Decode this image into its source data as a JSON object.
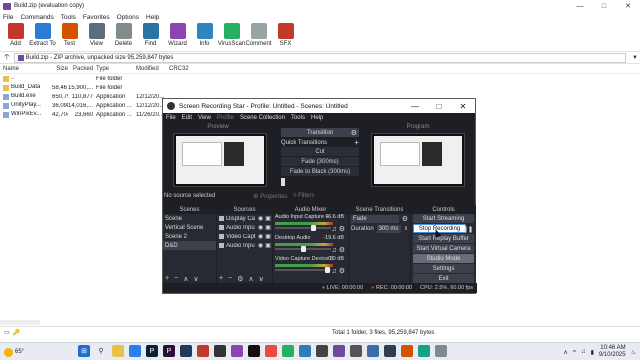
{
  "winrar": {
    "title": "Build.zip (evaluation copy)",
    "menu": [
      "File",
      "Commands",
      "Tools",
      "Favorites",
      "Options",
      "Help"
    ],
    "toolbar": [
      {
        "label": "Add",
        "icon": "add-archive-icon",
        "color": "#c0392b"
      },
      {
        "label": "Extract To",
        "icon": "extract-icon",
        "color": "#2e7bd6"
      },
      {
        "label": "Test",
        "icon": "test-icon",
        "color": "#d35400"
      },
      {
        "label": "View",
        "icon": "view-icon",
        "color": "#5d6d7e"
      },
      {
        "label": "Delete",
        "icon": "delete-icon",
        "color": "#7f8c8d"
      },
      {
        "label": "Find",
        "icon": "find-icon",
        "color": "#2874a6"
      },
      {
        "label": "Wizard",
        "icon": "wizard-icon",
        "color": "#8e44ad"
      },
      {
        "label": "Info",
        "icon": "info-icon",
        "color": "#2e86c1"
      },
      {
        "label": "VirusScan",
        "icon": "virusscan-icon",
        "color": "#27ae60"
      },
      {
        "label": "Comment",
        "icon": "comment-icon",
        "color": "#95a5a6"
      },
      {
        "label": "SFX",
        "icon": "sfx-icon",
        "color": "#c0392b"
      }
    ],
    "address": "Build.zip - ZIP archive, unpacked size 95,259,847 bytes",
    "columns": {
      "name": "Name",
      "size": "Size",
      "packed": "Packed",
      "type": "Type",
      "modified": "Modified",
      "crc": "CRC32"
    },
    "files": [
      {
        "name": "..",
        "size": "",
        "packed": "",
        "type": "File folder",
        "modified": "",
        "crc": "",
        "kind": "folder"
      },
      {
        "name": "Build_Data",
        "size": "58,467,...",
        "packed": "15,900,...",
        "type": "File folder",
        "modified": "",
        "crc": "",
        "kind": "folder"
      },
      {
        "name": "Build.exe",
        "size": "650,752",
        "packed": "110,877",
        "type": "Application",
        "modified": "12/12/20...",
        "crc": "",
        "kind": "file"
      },
      {
        "name": "UnityPlay...",
        "size": "36,098,...",
        "packed": "14,016,...",
        "type": "Application ...",
        "modified": "12/12/20...",
        "crc": "",
        "kind": "file"
      },
      {
        "name": "WinPixEv...",
        "size": "42,704",
        "packed": "23,660",
        "type": "Application ...",
        "modified": "11/26/20...",
        "crc": "",
        "kind": "file"
      }
    ],
    "status_right": "Total 1 folder, 3 files, 95,259,847 bytes"
  },
  "obs": {
    "title": "Screen Recording Star - Profile: Untitled - Scenes: Untitled",
    "menu": [
      "File",
      "Edit",
      "View",
      "Profile",
      "Scene Collection",
      "Tools",
      "Help"
    ],
    "preview_label": "Preview",
    "program_label": "Program",
    "transition_label": "Transition",
    "quick_transitions_label": "Quick Transitions",
    "quick_transitions": [
      "Cut",
      "Fade (300ms)",
      "Fade to Black (300ms)"
    ],
    "no_source": "No source selected",
    "properties_label": "Properties",
    "filters_label": "Filters",
    "docks": {
      "scenes": {
        "title": "Scenes",
        "items": [
          "Scene",
          "Vertical Scene",
          "Scene 2",
          "D&D"
        ],
        "selected": 3
      },
      "sources": {
        "title": "Sources",
        "items": [
          "Display Ca",
          "Audio Inpu",
          "Video Capt",
          "Audio Inpu"
        ]
      },
      "mixer": {
        "title": "Audio Mixer",
        "channels": [
          {
            "name": "Audio Input Capture 6",
            "db": "-6.6 dB"
          },
          {
            "name": "Desktop Audio",
            "db": "-19.6 dB"
          },
          {
            "name": "Video Capture Device 3",
            "db": "0.0 dB"
          }
        ]
      },
      "scene_transitions": {
        "title": "Scene Transitions",
        "type": "Fade",
        "duration_label": "Duration",
        "duration": "300 ms"
      },
      "controls": {
        "title": "Controls",
        "buttons": [
          "Start Streaming",
          "Stop Recording",
          "Start Replay Buffer",
          "Start Virtual Camera",
          "Studio Mode",
          "Settings",
          "Exit"
        ]
      }
    },
    "status": {
      "live": "LIVE: 00:00:00",
      "rec": "REC: 00:00:00",
      "cpu": "CPU: 2.5%, 60.00 fps"
    }
  },
  "taskbar": {
    "temperature": "65°",
    "clock_time": "10:46 AM",
    "clock_date": "9/10/2025"
  }
}
